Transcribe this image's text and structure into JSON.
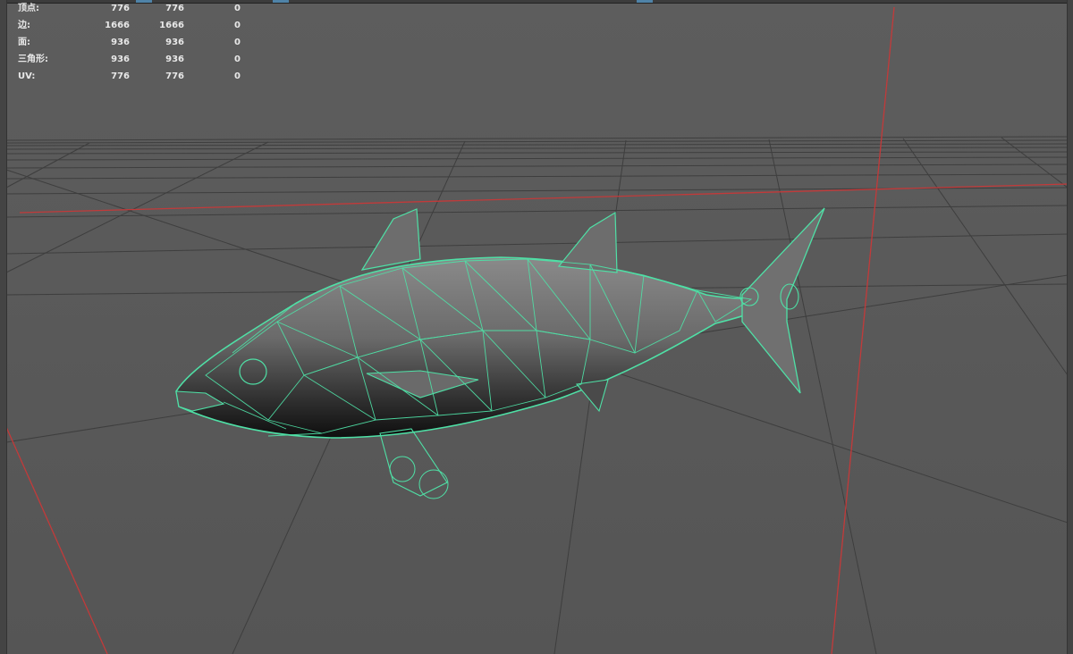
{
  "viewport": {
    "colors": {
      "background": "#5a5a5a",
      "grid": "#3d3d3d",
      "axis": "#c23a3a",
      "wireframe": "#4fe0a6"
    }
  },
  "hud": {
    "rows": [
      {
        "label": "顶点:",
        "v1": "776",
        "v2": "776",
        "v3": "0"
      },
      {
        "label": "边:",
        "v1": "1666",
        "v2": "1666",
        "v3": "0"
      },
      {
        "label": "面:",
        "v1": "936",
        "v2": "936",
        "v3": "0"
      },
      {
        "label": "三角形:",
        "v1": "936",
        "v2": "936",
        "v3": "0"
      },
      {
        "label": "UV:",
        "v1": "776",
        "v2": "776",
        "v3": "0"
      }
    ]
  },
  "model": {
    "icon": "tuna-fish-wireframe"
  }
}
